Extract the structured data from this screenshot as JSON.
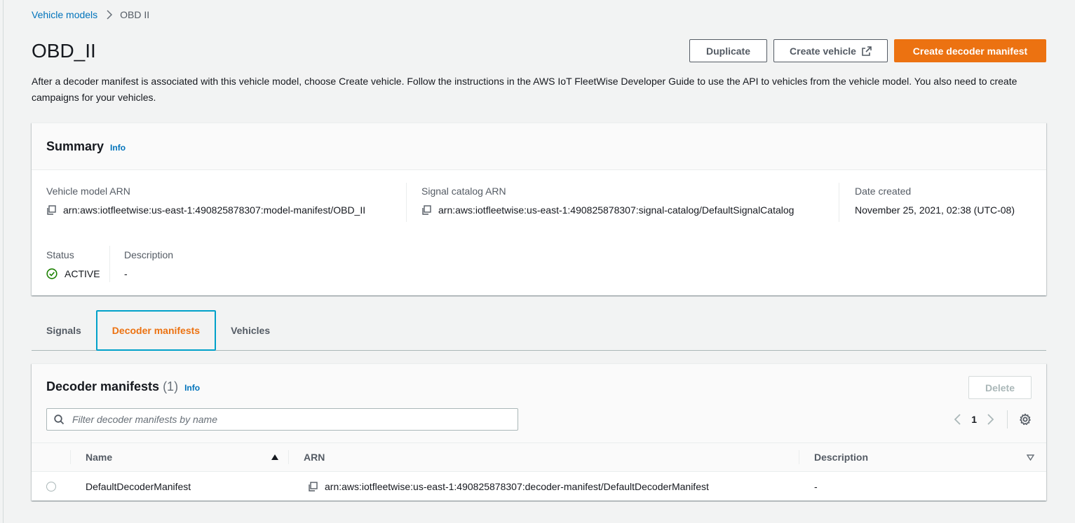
{
  "breadcrumb": {
    "parent": "Vehicle models",
    "current": "OBD II"
  },
  "header": {
    "title": "OBD_II",
    "description": "After a decoder manifest is associated with this vehicle model, choose Create vehicle. Follow the instructions in the AWS IoT FleetWise Developer Guide to use the API to vehicles from the vehicle model. You also need to create campaigns for your vehicles.",
    "actions": {
      "duplicate": "Duplicate",
      "create_vehicle": "Create vehicle",
      "create_decoder_manifest": "Create decoder manifest"
    }
  },
  "summary": {
    "title": "Summary",
    "info": "Info",
    "vehicle_model_arn_label": "Vehicle model ARN",
    "vehicle_model_arn": "arn:aws:iotfleetwise:us-east-1:490825878307:model-manifest/OBD_II",
    "signal_catalog_arn_label": "Signal catalog ARN",
    "signal_catalog_arn": "arn:aws:iotfleetwise:us-east-1:490825878307:signal-catalog/DefaultSignalCatalog",
    "date_created_label": "Date created",
    "date_created": "November 25, 2021, 02:38 (UTC-08)",
    "status_label": "Status",
    "status": "ACTIVE",
    "description_label": "Description",
    "description": "-"
  },
  "tabs": [
    {
      "label": "Signals",
      "active": false
    },
    {
      "label": "Decoder manifests",
      "active": true
    },
    {
      "label": "Vehicles",
      "active": false
    }
  ],
  "decoder_manifests": {
    "title": "Decoder manifests",
    "count": "(1)",
    "info": "Info",
    "delete_label": "Delete",
    "filter_placeholder": "Filter decoder manifests by name",
    "page": "1",
    "columns": {
      "name": "Name",
      "arn": "ARN",
      "description": "Description"
    },
    "rows": [
      {
        "name": "DefaultDecoderManifest",
        "arn": "arn:aws:iotfleetwise:us-east-1:490825878307:decoder-manifest/DefaultDecoderManifest",
        "description": "-"
      }
    ]
  },
  "colors": {
    "primary": "#ec7211",
    "link": "#0073bb",
    "success": "#1d8102",
    "focus": "#00a1c9"
  }
}
